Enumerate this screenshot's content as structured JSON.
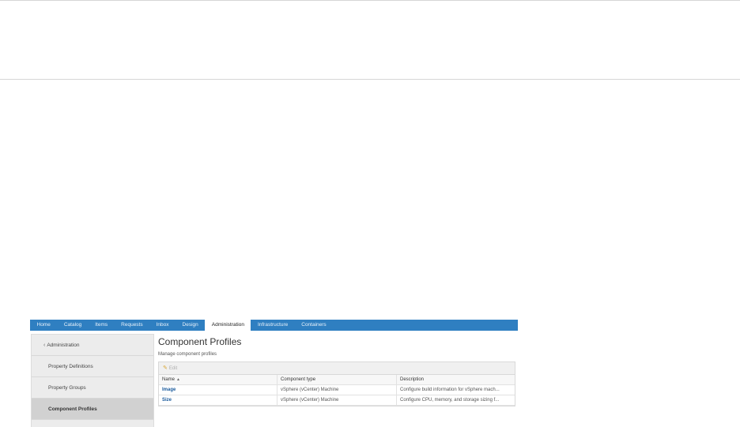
{
  "nav": {
    "tabs": [
      {
        "label": "Home"
      },
      {
        "label": "Catalog"
      },
      {
        "label": "Items"
      },
      {
        "label": "Requests"
      },
      {
        "label": "Inbox"
      },
      {
        "label": "Design"
      },
      {
        "label": "Administration",
        "active": true
      },
      {
        "label": "Infrastructure"
      },
      {
        "label": "Containers"
      }
    ],
    "color": "#2f7fc1"
  },
  "sidebar": {
    "back_label": "Administration",
    "items": [
      {
        "label": "Property Definitions"
      },
      {
        "label": "Property Groups"
      },
      {
        "label": "Component Profiles",
        "active": true
      }
    ]
  },
  "main": {
    "title": "Component Profiles",
    "subtitle": "Manage component profiles",
    "toolbar": {
      "edit_label": "Edit",
      "edit_icon": "pencil-icon"
    },
    "table": {
      "headers": [
        "Name",
        "Component type",
        "Description"
      ],
      "sort_indicator": "▲",
      "rows": [
        {
          "name": "Image",
          "type": "vSphere (vCenter) Machine",
          "description": "Configure build information for vSphere mach..."
        },
        {
          "name": "Size",
          "type": "vSphere (vCenter) Machine",
          "description": "Configure CPU, memory, and storage sizing f..."
        }
      ]
    }
  }
}
